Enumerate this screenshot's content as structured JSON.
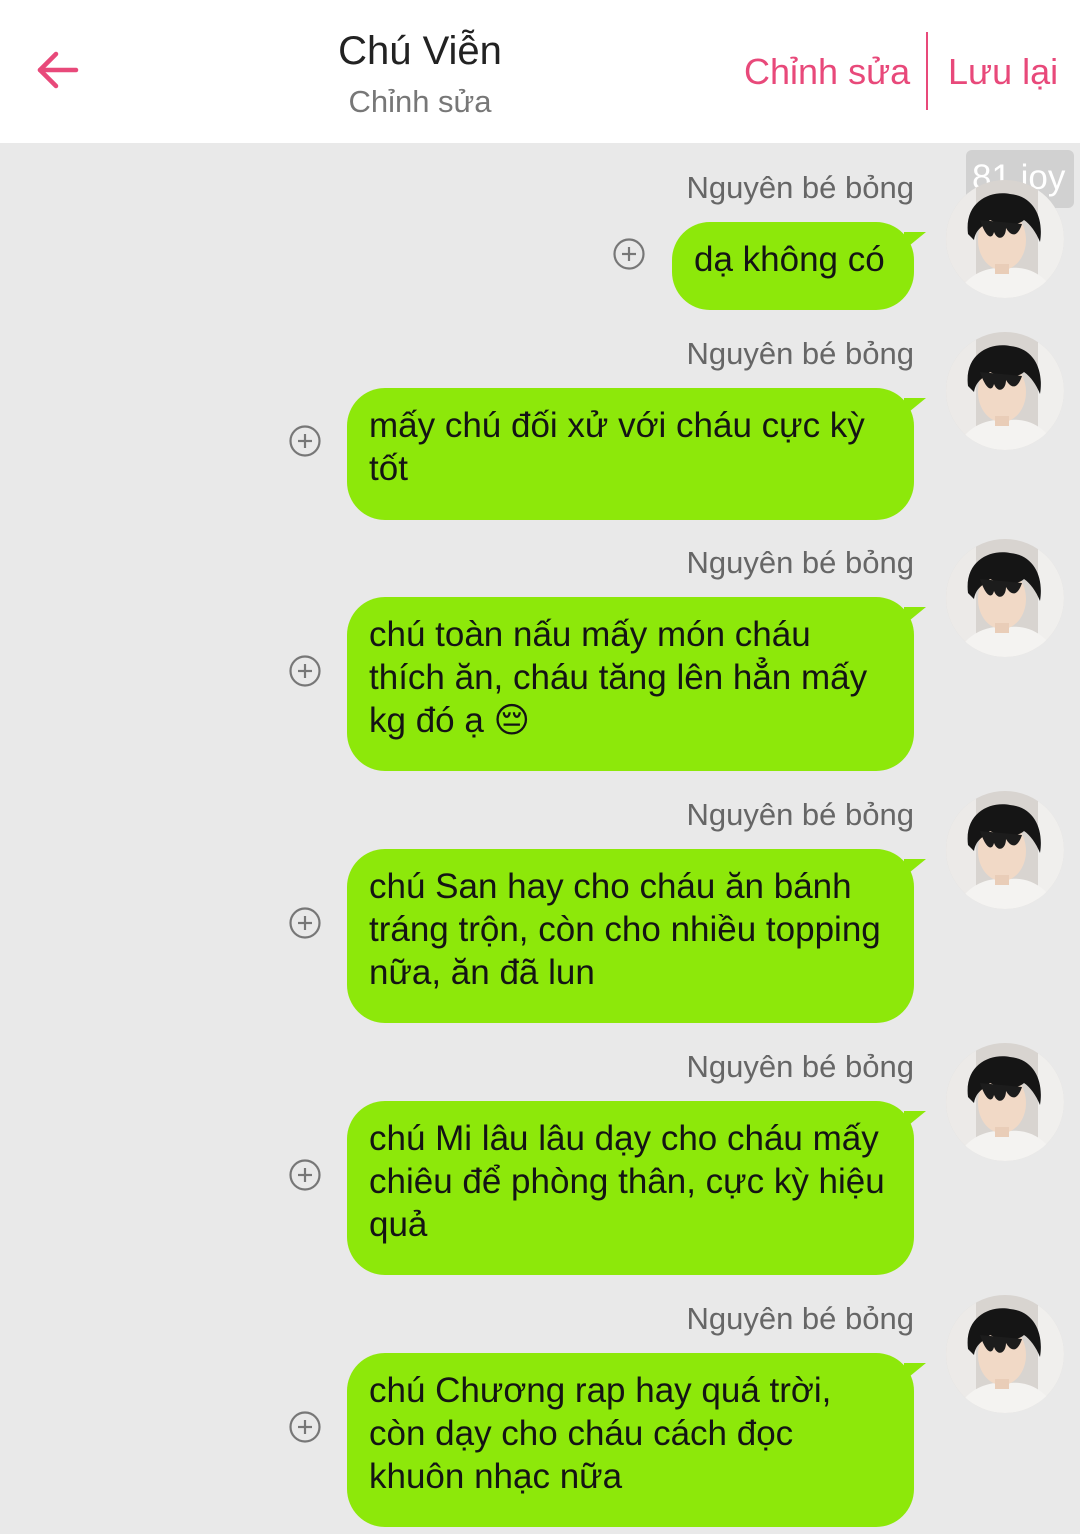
{
  "header": {
    "title": "Chú Viễn",
    "subtitle": "Chỉnh sửa",
    "edit_label": "Chỉnh sửa",
    "save_label": "Lưu lại"
  },
  "watermark": "81 joy",
  "colors": {
    "accent": "#e8497a",
    "bubble": "#8de80a",
    "background": "#e9e9e9"
  },
  "messages": [
    {
      "sender": "Nguyên bé bỏng",
      "text": "dạ không có"
    },
    {
      "sender": "Nguyên bé bỏng",
      "text": "mấy chú đối xử với cháu cực kỳ tốt"
    },
    {
      "sender": "Nguyên bé bỏng",
      "text": "chú toàn nấu mấy món cháu thích ăn, cháu tăng lên hẳn mấy kg đó ạ 😔"
    },
    {
      "sender": "Nguyên bé bỏng",
      "text": "chú San hay cho cháu ăn bánh tráng trộn, còn cho nhiều topping nữa, ăn đã lun"
    },
    {
      "sender": "Nguyên bé bỏng",
      "text": "chú Mi lâu lâu dạy cho cháu mấy chiêu để phòng thân, cực kỳ hiệu quả"
    },
    {
      "sender": "Nguyên bé bỏng",
      "text": "chú Chương rap hay quá trời, còn dạy cho cháu cách đọc khuôn nhạc nữa"
    }
  ]
}
